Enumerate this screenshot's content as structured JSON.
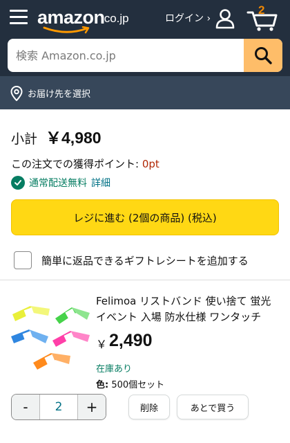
{
  "header": {
    "logo_text": "amazon",
    "logo_domain": ".co.jp",
    "login_label": "ログイン ›",
    "cart_count": "2",
    "accent_color": "#febd69",
    "cart_count_color": "#f08804"
  },
  "search": {
    "placeholder": "検索 Amazon.co.jp",
    "value": ""
  },
  "delivery": {
    "label": "お届け先を選択"
  },
  "cart": {
    "subtotal_label": "小計",
    "subtotal_value": "￥4,980",
    "points_label": "この注文での獲得ポイント: ",
    "points_value": "0pt",
    "shipping_text": "通常配送無料",
    "shipping_link": "詳細",
    "checkout_label": "レジに進む (2個の商品) (税込)",
    "gift_label": "簡単に返品できるギフトレシートを追加する"
  },
  "item": {
    "title": "Felimoa リストバンド 使い捨て 蛍光 イベント 入場 防水仕様 ワンタッチ",
    "price_symbol": "￥",
    "price": "2,490",
    "stock": "在庫あり",
    "variant_key": "色:",
    "variant_value": " 500個セット",
    "quantity_minus": "-",
    "quantity": "2",
    "quantity_plus": "+",
    "delete_label": "削除",
    "save_later_label": "あとで買う",
    "wristband_colors": [
      "#e9ef3a",
      "#46d34a",
      "#2f86e0",
      "#ff3fa8",
      "#ff8a1c"
    ]
  }
}
